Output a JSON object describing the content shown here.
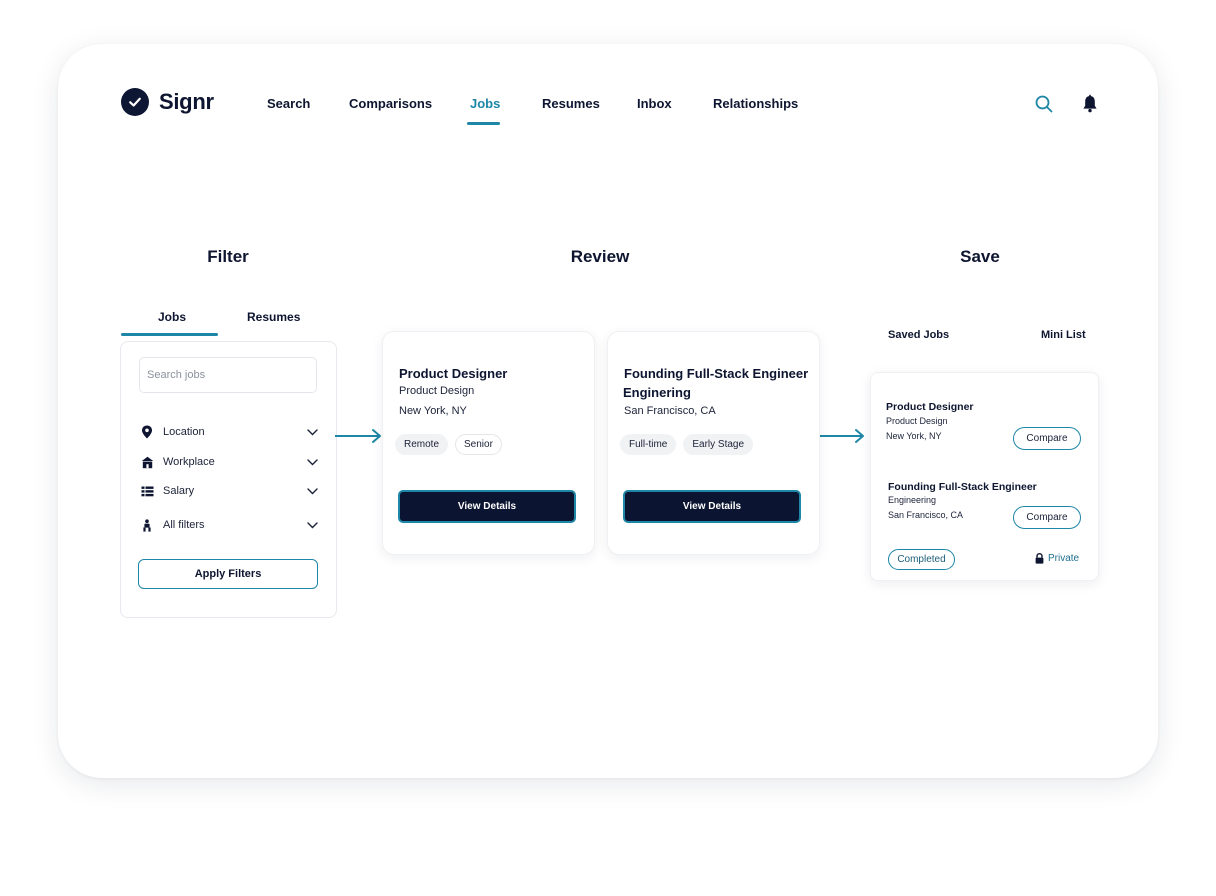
{
  "brand": {
    "name": "Signr"
  },
  "nav": {
    "items": [
      {
        "label": "Search"
      },
      {
        "label": "Comparisons"
      },
      {
        "label": "Jobs",
        "active": true
      },
      {
        "label": "Resumes"
      },
      {
        "label": "Inbox"
      },
      {
        "label": "Relationships"
      }
    ],
    "icons": [
      "search-icon",
      "bell-icon"
    ]
  },
  "sections": {
    "filter": "Filter",
    "review": "Review",
    "save": "Save"
  },
  "filter_panel": {
    "tabs": [
      {
        "label": "Jobs",
        "active": true
      },
      {
        "label": "Resumes"
      }
    ],
    "search_placeholder": "Search jobs",
    "filters": [
      {
        "label": "Location",
        "icon": "location-pin-icon"
      },
      {
        "label": "Workplace",
        "icon": "workplace-icon"
      },
      {
        "label": "Salary",
        "icon": "salary-icon"
      },
      {
        "label": "All filters",
        "icon": "filters-icon"
      }
    ],
    "apply_label": "Apply Filters"
  },
  "jobs": [
    {
      "title": "Product Designer",
      "department": "Product Design",
      "location": "New York, NY",
      "tags": [
        "Remote",
        "Senior"
      ],
      "button": "View Details"
    },
    {
      "title": "Founding Full-Stack Engineer",
      "department": "Enginering",
      "location": "San Francisco, CA",
      "tags": [
        "Full-time",
        "Early Stage"
      ],
      "button": "View Details"
    }
  ],
  "saved_panel": {
    "headers": {
      "saved": "Saved Jobs",
      "mini": "Mini List"
    },
    "items": [
      {
        "title": "Product Designer",
        "department": "Product Design",
        "location": "New York, NY",
        "button": "Compare"
      },
      {
        "title": "Founding Full-Stack Engineer",
        "department": "Engineering",
        "location": "San Francisco, CA",
        "button": "Compare"
      }
    ],
    "status": "Completed",
    "privacy": "Private"
  },
  "colors": {
    "accent": "#1e86a6",
    "navy": "#0b1430",
    "text": "#0d1530"
  }
}
